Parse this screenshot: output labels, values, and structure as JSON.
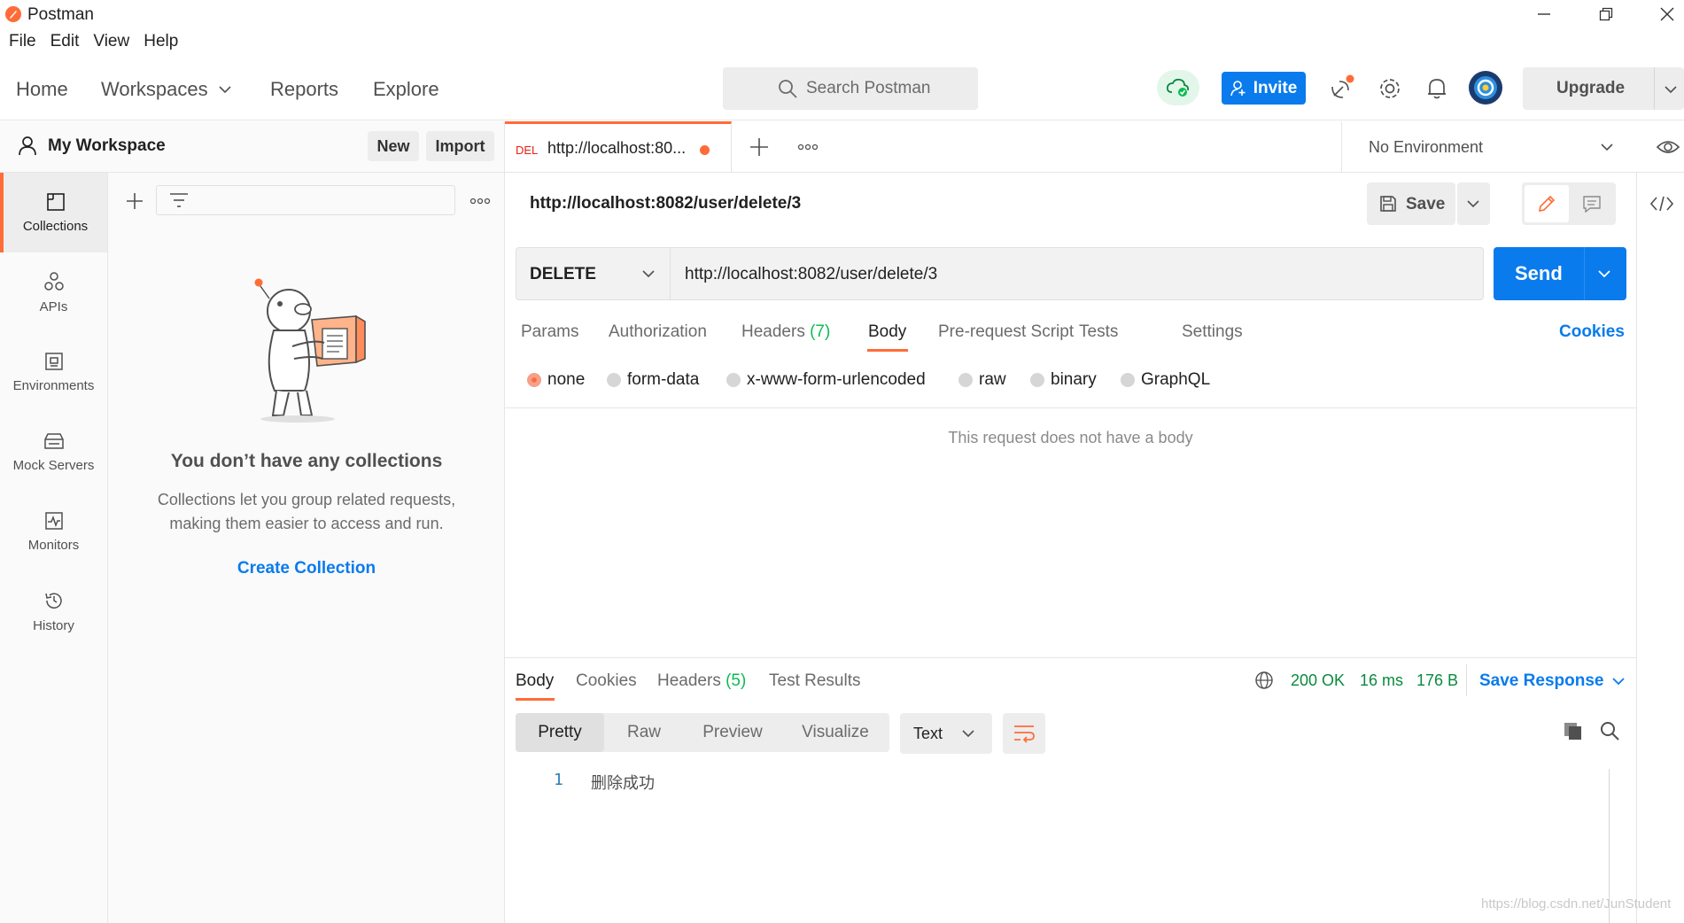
{
  "app": {
    "title": "Postman"
  },
  "menu": [
    "File",
    "Edit",
    "View",
    "Help"
  ],
  "header": {
    "home": "Home",
    "workspaces": "Workspaces",
    "reports": "Reports",
    "explore": "Explore",
    "search_placeholder": "Search Postman",
    "invite": "Invite",
    "upgrade": "Upgrade"
  },
  "workspace": {
    "name": "My Workspace",
    "new_label": "New",
    "import_label": "Import"
  },
  "rail": [
    {
      "label": "Collections",
      "icon": "collections-icon",
      "active": true
    },
    {
      "label": "APIs",
      "icon": "apis-icon"
    },
    {
      "label": "Environments",
      "icon": "environments-icon"
    },
    {
      "label": "Mock Servers",
      "icon": "mock-servers-icon"
    },
    {
      "label": "Monitors",
      "icon": "monitors-icon"
    },
    {
      "label": "History",
      "icon": "history-icon"
    }
  ],
  "collections": {
    "empty_title": "You don’t have any collections",
    "empty_desc_1": "Collections let you group related requests,",
    "empty_desc_2": "making them easier to access and run.",
    "create_label": "Create Collection"
  },
  "tab": {
    "method": "DEL",
    "url": "http://localhost:80...",
    "unsaved": true
  },
  "environment": {
    "selected": "No Environment"
  },
  "request": {
    "name": "http://localhost:8082/user/delete/3",
    "save_label": "Save",
    "method": "DELETE",
    "url": "http://localhost:8082/user/delete/3",
    "send_label": "Send",
    "tabs": {
      "params": "Params",
      "authorization": "Authorization",
      "headers": "Headers",
      "headers_count": "(7)",
      "body": "Body",
      "prerequest": "Pre-request Script",
      "tests": "Tests",
      "settings": "Settings",
      "cookies": "Cookies"
    },
    "body_types": {
      "none": "none",
      "form_data": "form-data",
      "urlencoded": "x-www-form-urlencoded",
      "raw": "raw",
      "binary": "binary",
      "graphql": "GraphQL"
    },
    "body_selected": "none",
    "no_body_text": "This request does not have a body"
  },
  "response": {
    "tabs": {
      "body": "Body",
      "cookies": "Cookies",
      "headers": "Headers",
      "headers_count": "(5)",
      "test_results": "Test Results"
    },
    "status": "200 OK",
    "time": "16 ms",
    "size": "176 B",
    "save_label": "Save Response",
    "views": {
      "pretty": "Pretty",
      "raw": "Raw",
      "preview": "Preview",
      "visualize": "Visualize"
    },
    "format": "Text",
    "line_number": "1",
    "line_text": "删除成功"
  },
  "watermark": "https://blog.csdn.net/JunStudent",
  "colors": {
    "accent": "#ff6c37",
    "primary": "#097bed",
    "success": "#0cbb52"
  }
}
